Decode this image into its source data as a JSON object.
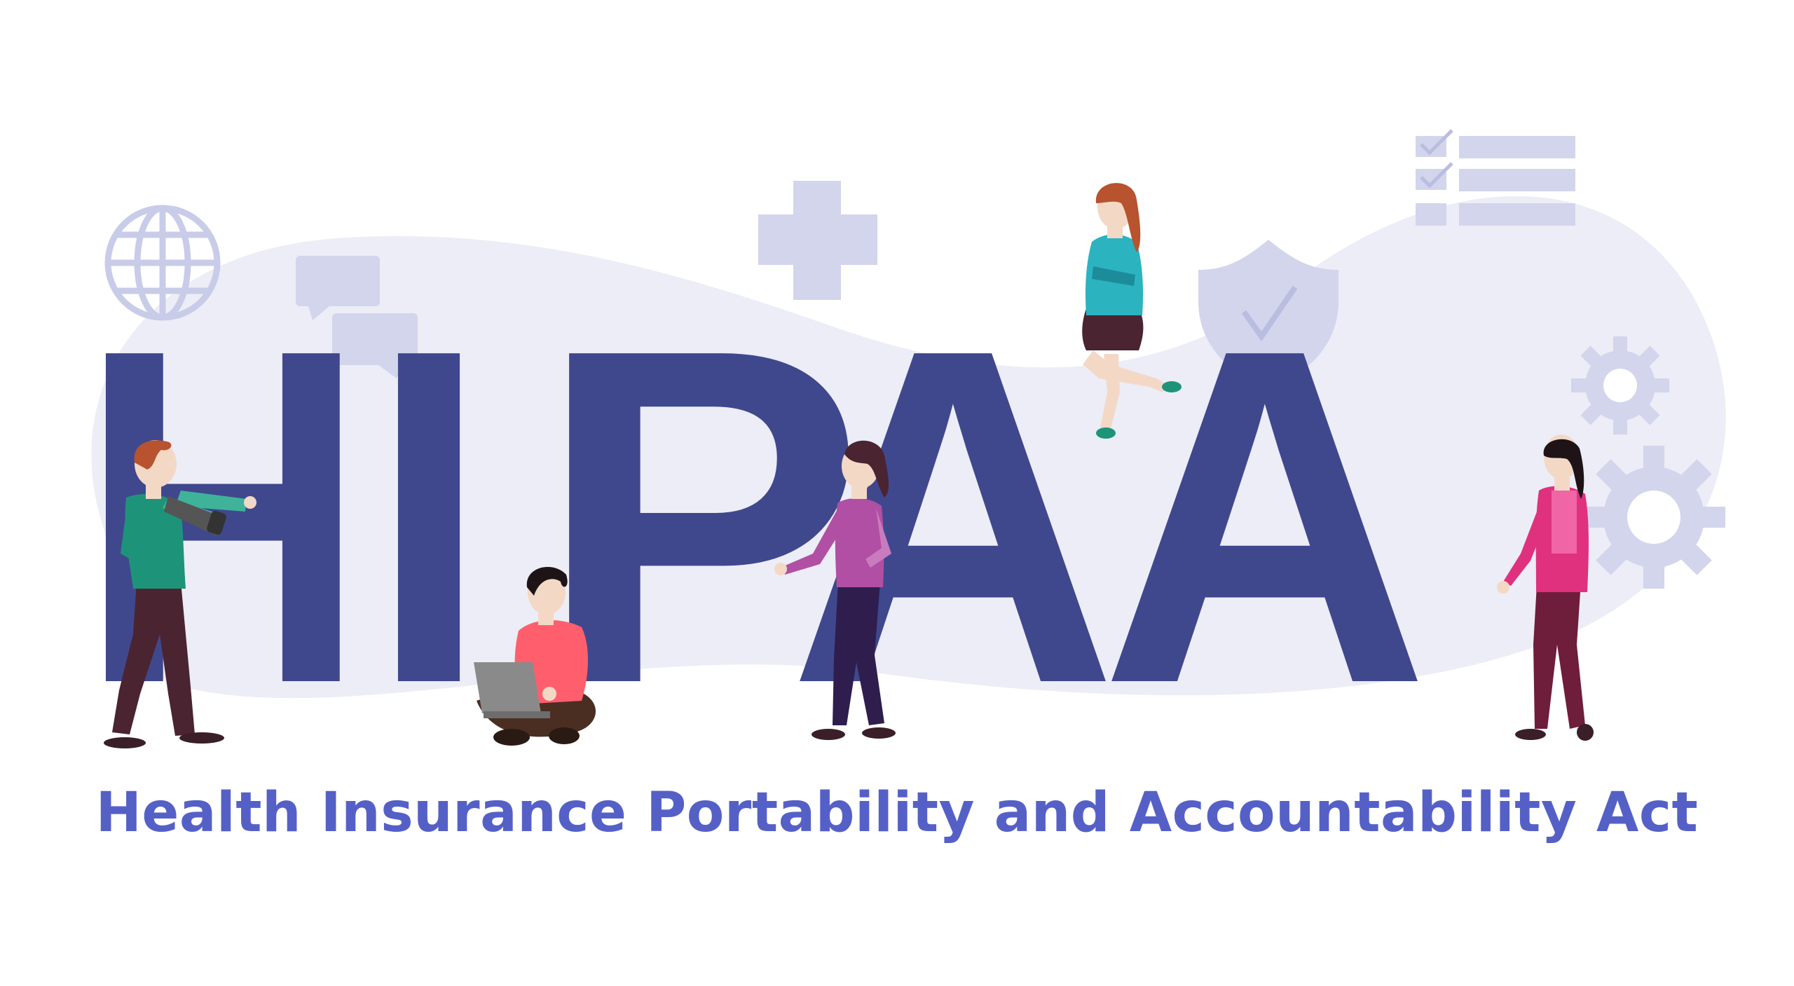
{
  "headline": {
    "letters": [
      "H",
      "I",
      "P",
      "A",
      "A"
    ]
  },
  "subtitle": "Health Insurance Portability and Accountability Act",
  "icons": [
    "globe-icon",
    "chat-bubbles-icon",
    "medical-cross-icon",
    "shield-check-icon",
    "checklist-icon",
    "gear-icon"
  ],
  "colors": {
    "letters": "#3f488d",
    "subtitle": "#5560c7",
    "background_blob": "#ecedf6",
    "icons": "#d2d5ec",
    "icon_stroke": "#b9bddf"
  }
}
